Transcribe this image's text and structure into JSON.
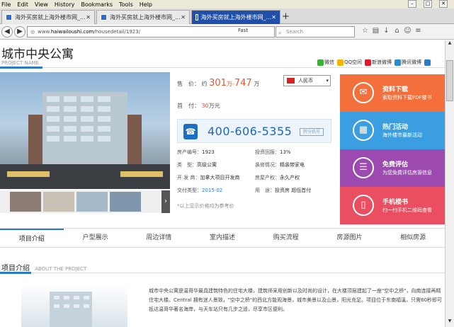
{
  "browser": {
    "menu": [
      "File",
      "Edit",
      "View",
      "History",
      "Bookmarks",
      "Tools",
      "Help"
    ],
    "tabs": [
      {
        "label": "海外买房就上海外楼市网_..."
      },
      {
        "label": "海外买房就上海外楼市网_..."
      },
      {
        "label": "海外买房就上海外楼市网_..."
      }
    ],
    "url_prefix": "www.",
    "url_host": "haiwailoushi.com",
    "url_path": "/housedetail/1923/",
    "url_right": "Fast",
    "search_placeholder": "Search"
  },
  "page": {
    "title": "城市中央公寓",
    "subtitle": "PROJECT NAME",
    "share": [
      "微信",
      "QQ空间",
      "新浪微博",
      "腾讯微博"
    ],
    "price_label": "售　价：",
    "price_prefix": "约",
    "price_low": "301",
    "price_sep": "万-",
    "price_high": "747",
    "price_unit": "万",
    "currency": "人民币",
    "down_label": "首　付：",
    "down_value": "30",
    "down_unit": "万元",
    "phone": "400-606-5355",
    "phone_tag": "转分机号",
    "details": [
      {
        "k": "房产编号：",
        "v": "1923"
      },
      {
        "k": "投资回报：",
        "v": "13%"
      },
      {
        "k": "类　型：",
        "v": "高级公寓"
      },
      {
        "k": "装修情况：",
        "v": "精装带家电"
      },
      {
        "k": "开 发 商：",
        "v": "加拿大项目开发商"
      },
      {
        "k": "房屋产权：",
        "v": "永久产权"
      },
      {
        "k": "交付类型：",
        "v": "2015-02"
      },
      {
        "k": "用　途：",
        "v": "投资房 超低首付"
      }
    ],
    "note": "*以上显示价格均为参考价",
    "tiles": [
      {
        "title": "资料下载",
        "sub": "索取资料下载PDF楼书",
        "color": "#f36f3c",
        "icon": "doc-icon"
      },
      {
        "title": "热门活动",
        "sub": "海外楼市最新活动",
        "color": "#3a9ee0",
        "icon": "calendar-icon"
      },
      {
        "title": "免费评估",
        "sub": "为您免费评估房源信息",
        "color": "#9c4ab0",
        "icon": "list-icon"
      },
      {
        "title": "手机楼书",
        "sub": "扫一扫手机二维码查看",
        "color": "#ea4f61",
        "icon": "phone-icon"
      }
    ],
    "tabs": [
      "项目介绍",
      "户型展示",
      "周边详情",
      "室内描述",
      "购买流程",
      "房源图片",
      "相似房源"
    ],
    "section_title": "项目介绍",
    "section_en": "ABOUT THE PROJECT",
    "description": "城市中央公寓是温哥华最具建筑特色的住宅大楼，建筑师采用创新以及时尚的设计，在大楼顶层建起了一座\"空中之桥\"，向南连接再精住宅大楼。Central 拥有迷人景致，\"空中之桥\"的西北方能观海景，城市美景以及山景，阳光充足。项目位于东南福溪，只需60秒即可抵达温哥华著名海岸，与天车站只有几步之遥，尽享市区便利。"
  }
}
